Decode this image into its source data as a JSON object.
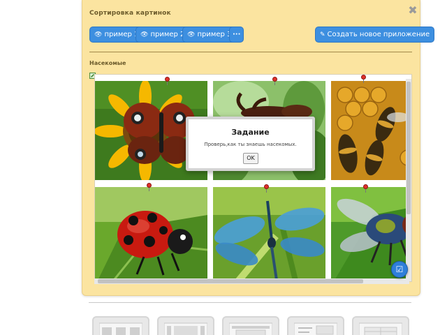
{
  "panel": {
    "title": "Сортировка картинок",
    "close_icon": "close-icon"
  },
  "toolbar": {
    "example1": "пример 1",
    "example2": "пример 2",
    "example3": "пример 3",
    "more": "···",
    "create": "Создать новое приложение",
    "accent_color": "#3d8fe0"
  },
  "section": {
    "label": "Насекомые"
  },
  "images": [
    {
      "name": "butterfly-on-sunflower"
    },
    {
      "name": "stag-beetle"
    },
    {
      "name": "bees-on-honeycomb"
    },
    {
      "name": "ladybug-on-leaf"
    },
    {
      "name": "dragonfly"
    },
    {
      "name": "fly"
    }
  ],
  "modal": {
    "title": "Задание",
    "text": "Проверь,как ты знаешь насекомых.",
    "ok": "OK"
  },
  "bottom_tools": [
    {
      "name": "grid-layout-tool"
    },
    {
      "name": "filmstrip-tool"
    },
    {
      "name": "window-tool"
    },
    {
      "name": "text-block-tool"
    },
    {
      "name": "table-tool"
    }
  ]
}
